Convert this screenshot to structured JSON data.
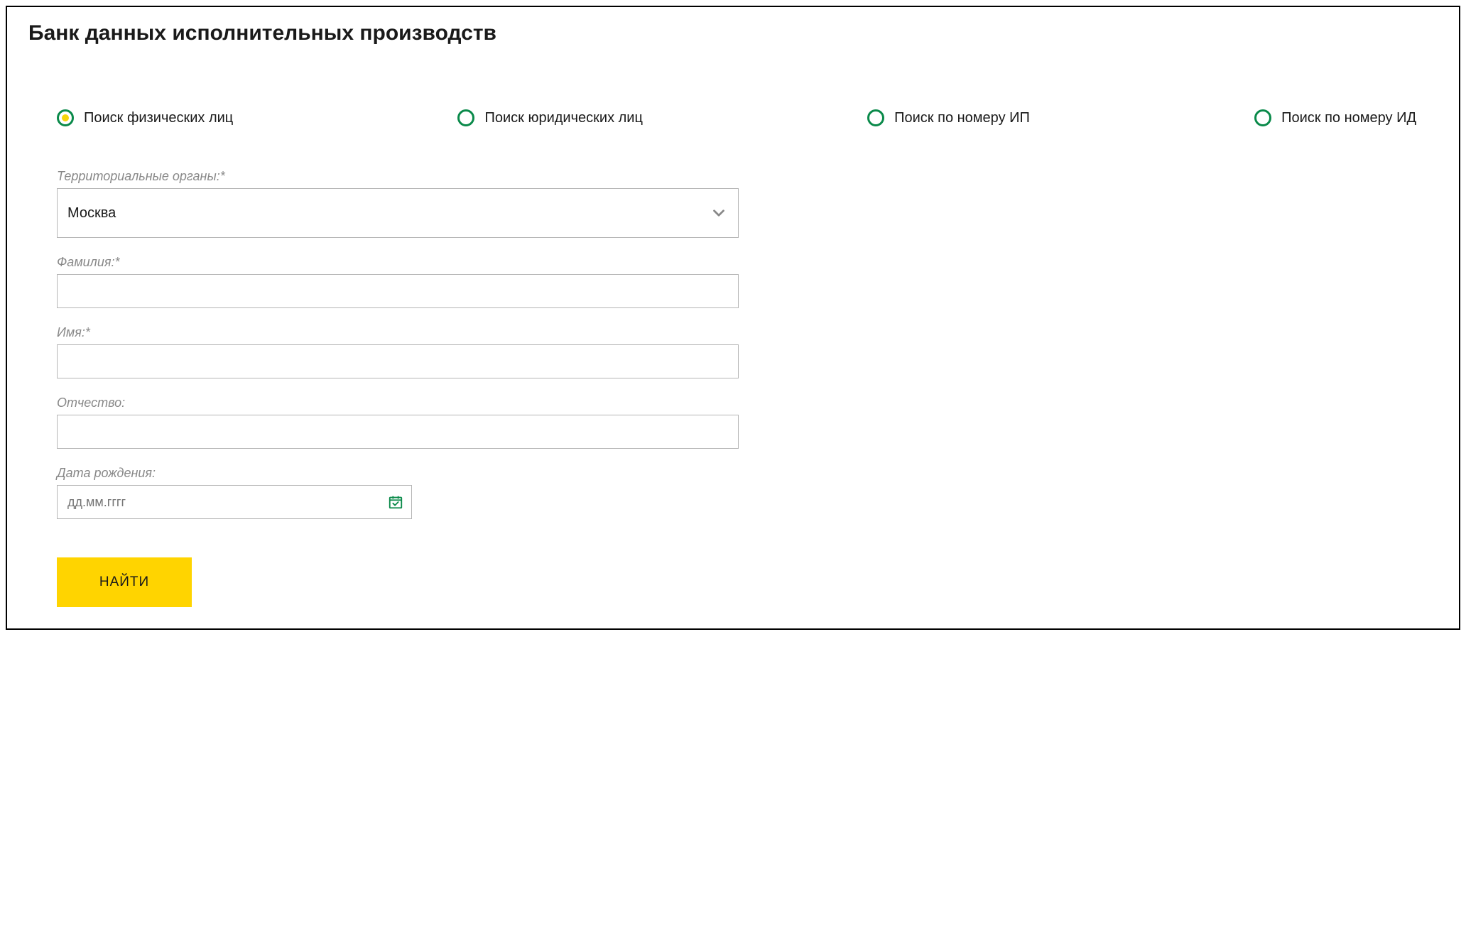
{
  "title": "Банк данных исполнительных производств",
  "searchTypes": [
    {
      "label": "Поиск физических лиц",
      "selected": true
    },
    {
      "label": "Поиск юридических лиц",
      "selected": false
    },
    {
      "label": "Поиск по номеру ИП",
      "selected": false
    },
    {
      "label": "Поиск по номеру ИД",
      "selected": false
    }
  ],
  "fields": {
    "territory": {
      "label": "Территориальные органы:*",
      "value": "Москва"
    },
    "surname": {
      "label": "Фамилия:*",
      "value": ""
    },
    "name": {
      "label": "Имя:*",
      "value": ""
    },
    "patronymic": {
      "label": "Отчество:",
      "value": ""
    },
    "birthdate": {
      "label": "Дата рождения:",
      "placeholder": "дд.мм.гггг",
      "value": ""
    }
  },
  "submitLabel": "НАЙТИ"
}
